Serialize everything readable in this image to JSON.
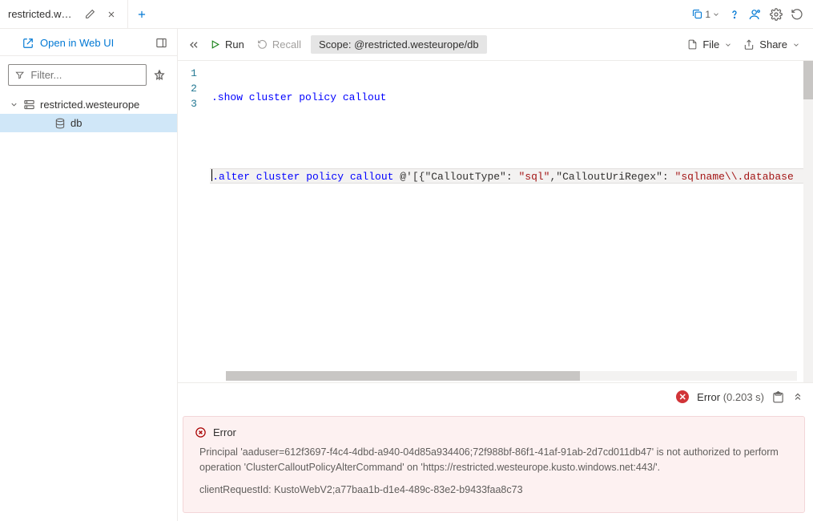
{
  "tabs": {
    "items": [
      {
        "label": "restricted.westeur..."
      }
    ]
  },
  "top_right": {
    "copy_count": "1"
  },
  "sidebar": {
    "open_web_label": "Open in Web UI",
    "filter_placeholder": "Filter...",
    "tree": {
      "cluster_label": "restricted.westeurope",
      "db_label": "db"
    }
  },
  "toolbar": {
    "run_label": "Run",
    "recall_label": "Recall",
    "scope_label": "Scope:",
    "scope_value": "@restricted.westeurope/db",
    "file_label": "File",
    "share_label": "Share"
  },
  "editor": {
    "lines": [
      "1",
      "2",
      "3"
    ],
    "line1_cmd": ".show cluster policy callout",
    "line3": {
      "cmd": ".alter cluster policy callout",
      "at": " @'",
      "body_a": "[{\"CalloutType\": ",
      "str_a": "\"sql\"",
      "body_b": ",\"CalloutUriRegex\": ",
      "str_b": "\"sqlname\\\\.database"
    }
  },
  "results": {
    "status_label": "Error",
    "status_time": "(0.203 s)"
  },
  "error": {
    "title": "Error",
    "msg1": "Principal 'aaduser=612f3697-f4c4-4dbd-a940-04d85a934406;72f988bf-86f1-41af-91ab-2d7cd011db47' is not authorized to perform operation 'ClusterCalloutPolicyAlterCommand' on 'https://restricted.westeurope.kusto.windows.net:443/'.",
    "msg2": "clientRequestId: KustoWebV2;a77baa1b-d1e4-489c-83e2-b9433faa8c73"
  }
}
